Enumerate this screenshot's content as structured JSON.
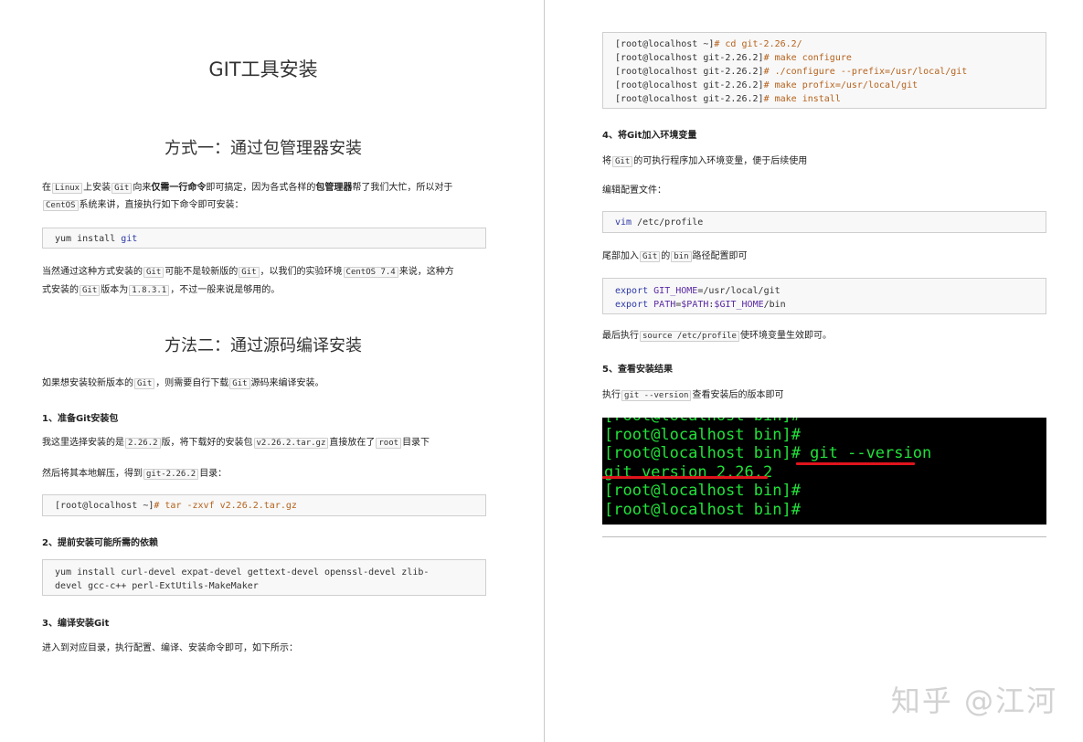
{
  "left": {
    "title": "GIT工具安装",
    "section1": {
      "heading": "方式一：通过包管理器安装",
      "p1": {
        "a": "在",
        "linux": "Linux",
        "b": "上安装",
        "git": "Git",
        "c": "向来",
        "bold1": "仅需一行命令",
        "d": "即可搞定，因为各式各样的",
        "bold2": "包管理器",
        "e": "帮了我们大忙，所以对于"
      },
      "p1b": {
        "centos": "CentOS",
        "a": "系统来讲，直接执行如下命令即可安装："
      },
      "code": {
        "prefix": "yum install ",
        "kw": "git"
      },
      "p2": {
        "a": "当然通过这种方式安装的",
        "git1": "Git",
        "b": "可能不是较新版的",
        "git2": "Git",
        "c": "，以我们的实验环境",
        "centos": "CentOS 7.4",
        "d": "来说，这种方"
      },
      "p2b": {
        "a": "式安装的",
        "git": "Git",
        "b": "版本为",
        "ver": "1.8.3.1",
        "c": "，不过一般来说是够用的。"
      }
    },
    "section2": {
      "heading": "方法二：通过源码编译安装",
      "p1": {
        "a": "如果想安装较新版本的",
        "git1": "Git",
        "b": "，则需要自行下载",
        "git2": "Git",
        "c": "源码来编译安装。"
      },
      "step1": "1、准备Git安装包",
      "p2": {
        "a": "我这里选择安装的是",
        "ver": "2.26.2",
        "b": "版，将下载好的安装包",
        "pkg": "v2.26.2.tar.gz",
        "c": "直接放在了",
        "root": "root",
        "d": "目录下"
      },
      "p3": {
        "a": "然后将其本地解压，得到",
        "dir": "git-2.26.2",
        "b": "目录："
      },
      "code1": {
        "prefix": "[root@localhost ~]",
        "cmd": "# tar -zxvf v2.26.2.tar.gz"
      },
      "step2": "2、提前安装可能所需的依赖",
      "code2": {
        "line1": "yum install curl-devel expat-devel gettext-devel openssl-devel zlib-",
        "line2": "devel gcc-c++ perl-ExtUtils-MakeMaker"
      },
      "step3": "3、编译安装Git",
      "p4": "进入到对应目录，执行配置、编译、安装命令即可，如下所示："
    }
  },
  "right": {
    "code_build": [
      {
        "prompt": "[root@localhost ~]",
        "cmd": "# cd git-2.26.2/"
      },
      {
        "prompt": "[root@localhost git-2.26.2]",
        "cmd": "# make configure"
      },
      {
        "prompt": "[root@localhost git-2.26.2]",
        "cmd": "# ./configure --prefix=/usr/local/git"
      },
      {
        "prompt": "[root@localhost git-2.26.2]",
        "cmd": "# make profix=/usr/local/git"
      },
      {
        "prompt": "[root@localhost git-2.26.2]",
        "cmd": "# make install"
      }
    ],
    "step4": "4、将Git加入环境变量",
    "p1": {
      "a": "将",
      "git": "Git",
      "b": "的可执行程序加入环境变量，便于后续使用"
    },
    "p2": "编辑配置文件：",
    "code_vim": {
      "kw": "vim",
      "rest": " /etc/profile"
    },
    "p3": {
      "a": "尾部加入",
      "git": "Git",
      "b": "的",
      "bin": "bin",
      "c": "路径配置即可"
    },
    "code_export": {
      "l1": {
        "kw": "export",
        "var": "GIT_HOME",
        "rest": "=/usr/local/git"
      },
      "l2": {
        "kw": "export",
        "var": "PATH",
        "eq": "=",
        "v1": "$PATH",
        "colon": ":",
        "v2": "$GIT_HOME",
        "rest": "/bin"
      }
    },
    "p4": {
      "a": "最后执行",
      "cmd": "source /etc/profile",
      "b": "使环境变量生效即可。"
    },
    "step5": "5、查看安装结果",
    "p5": {
      "a": "执行",
      "cmd": "git --version",
      "b": "查看安装后的版本即可"
    },
    "terminal": {
      "line0": "[root@localhost bin]#",
      "line1": "[root@localhost bin]#",
      "line2": "[root@localhost bin]# git --version",
      "line3": "git version 2.26.2",
      "line4": "[root@localhost bin]#",
      "line5": "[root@localhost bin]#"
    }
  },
  "watermark": "知乎 @江河"
}
